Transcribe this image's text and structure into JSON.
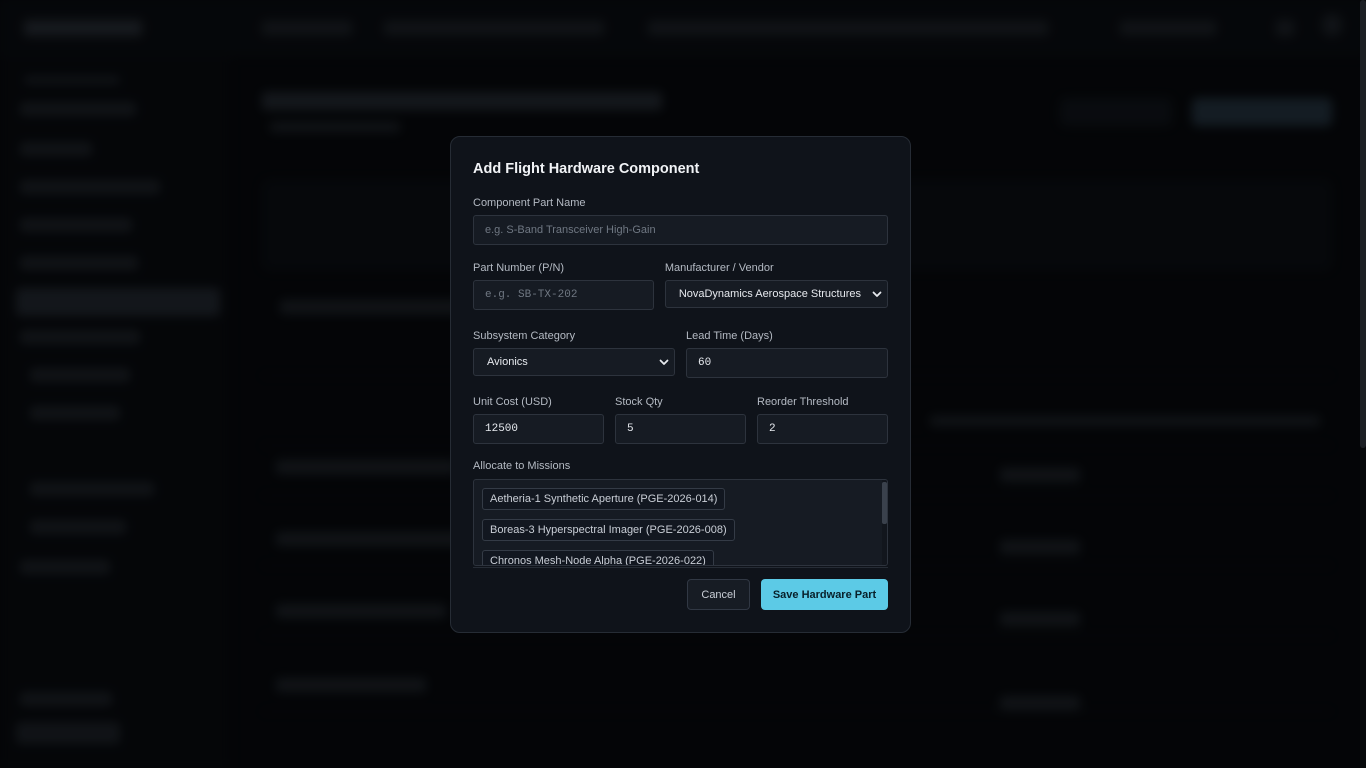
{
  "modal": {
    "title": "Add Flight Hardware Component",
    "part_name": {
      "label": "Component Part Name",
      "placeholder": "e.g. S-Band Transceiver High-Gain",
      "value": ""
    },
    "part_number": {
      "label": "Part Number (P/N)",
      "placeholder": "e.g. SB-TX-202",
      "value": ""
    },
    "vendor": {
      "label": "Manufacturer / Vendor",
      "selected": "NovaDynamics Aerospace Structures"
    },
    "subsystem": {
      "label": "Subsystem Category",
      "selected": "Avionics"
    },
    "lead_time": {
      "label": "Lead Time (Days)",
      "value": "60"
    },
    "unit_cost": {
      "label": "Unit Cost (USD)",
      "value": "12500"
    },
    "stock_qty": {
      "label": "Stock Qty",
      "value": "5"
    },
    "reorder_threshold": {
      "label": "Reorder Threshold",
      "value": "2"
    },
    "missions": {
      "label": "Allocate to Missions",
      "options": [
        "Aetheria-1 Synthetic Aperture (PGE-2026-014)",
        "Boreas-3 Hyperspectral Imager (PGE-2026-008)",
        "Chronos Mesh-Node Alpha (PGE-2026-022)"
      ]
    },
    "cancel_label": "Cancel",
    "save_label": "Save Hardware Part"
  },
  "colors": {
    "accent": "#5ccae6",
    "modal_bg": "#0f131a",
    "input_bg": "#161b23",
    "page_bg": "#07090c"
  }
}
